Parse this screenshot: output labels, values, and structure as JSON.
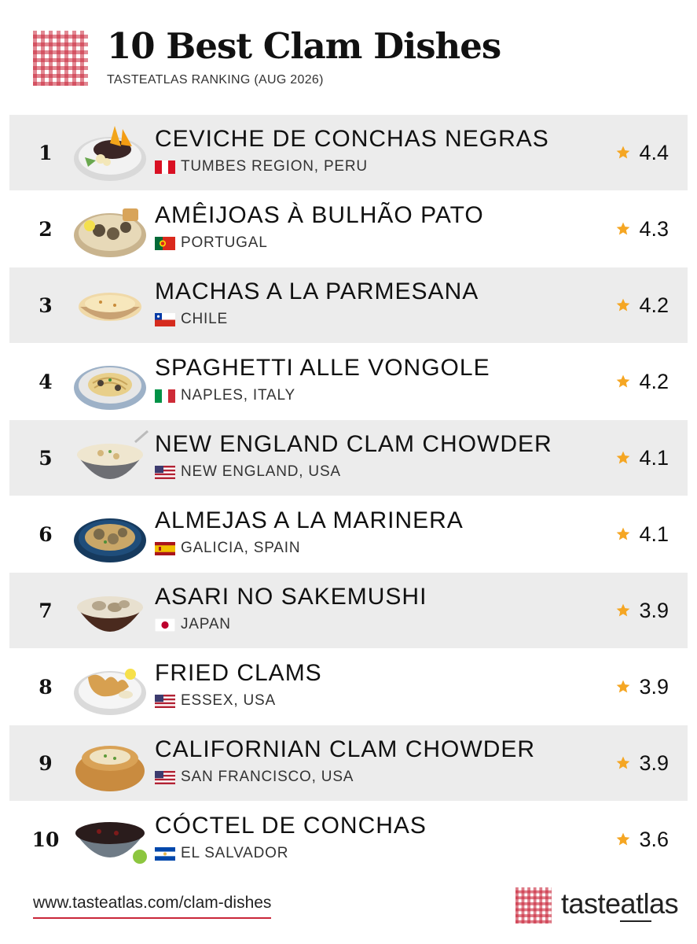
{
  "header": {
    "title": "10 Best Clam Dishes",
    "subtitle": "TASTEATLAS RANKING (AUG 2026)"
  },
  "colors": {
    "brand_red": "#c9263a",
    "row_shade": "#ececec",
    "star": "#f5a623"
  },
  "dishes": [
    {
      "rank": "1",
      "name": "CEVICHE DE CONCHAS NEGRAS",
      "origin": "TUMBES REGION, PERU",
      "flag": "peru-flag",
      "rating": "4.4",
      "image": "ceviche-dish-image"
    },
    {
      "rank": "2",
      "name": "AMÊIJOAS À BULHÃO PATO",
      "origin": "PORTUGAL",
      "flag": "portugal-flag",
      "rating": "4.3",
      "image": "clams-plate-image"
    },
    {
      "rank": "3",
      "name": "MACHAS A LA PARMESANA",
      "origin": "CHILE",
      "flag": "chile-flag",
      "rating": "4.2",
      "image": "baked-clam-image"
    },
    {
      "rank": "4",
      "name": "SPAGHETTI ALLE VONGOLE",
      "origin": "NAPLES, ITALY",
      "flag": "italy-flag",
      "rating": "4.2",
      "image": "spaghetti-image"
    },
    {
      "rank": "5",
      "name": "NEW ENGLAND CLAM CHOWDER",
      "origin": "NEW ENGLAND, USA",
      "flag": "usa-flag",
      "rating": "4.1",
      "image": "chowder-bowl-image"
    },
    {
      "rank": "6",
      "name": "ALMEJAS A LA MARINERA",
      "origin": "GALICIA, SPAIN",
      "flag": "spain-flag",
      "rating": "4.1",
      "image": "clam-pan-image"
    },
    {
      "rank": "7",
      "name": "ASARI NO SAKEMUSHI",
      "origin": "JAPAN",
      "flag": "japan-flag",
      "rating": "3.9",
      "image": "clam-bowl-image"
    },
    {
      "rank": "8",
      "name": "FRIED CLAMS",
      "origin": "ESSEX, USA",
      "flag": "usa-flag",
      "rating": "3.9",
      "image": "fried-clams-image"
    },
    {
      "rank": "9",
      "name": "CALIFORNIAN CLAM CHOWDER",
      "origin": "SAN FRANCISCO, USA",
      "flag": "usa-flag",
      "rating": "3.9",
      "image": "bread-bowl-image"
    },
    {
      "rank": "10",
      "name": "CÓCTEL DE CONCHAS",
      "origin": "EL SALVADOR",
      "flag": "el-salvador-flag",
      "rating": "3.6",
      "image": "cocktail-bowl-image"
    }
  ],
  "footer": {
    "url": "www.tasteatlas.com/clam-dishes",
    "brand": "tasteatlas"
  }
}
